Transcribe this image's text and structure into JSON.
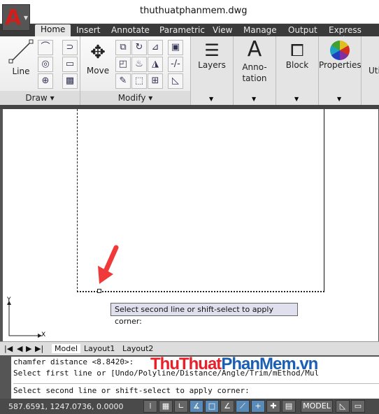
{
  "window": {
    "title": "thuthuatphanmem.dwg",
    "app_icon": "autocad-logo-icon"
  },
  "tabs": [
    "Home",
    "Insert",
    "Annotate",
    "Parametric",
    "View",
    "Manage",
    "Output",
    "Express Tools"
  ],
  "ribbon": {
    "draw": {
      "label": "Draw",
      "line": "Line"
    },
    "modify": {
      "label": "Modify",
      "move": "Move"
    },
    "layers": "Layers",
    "annotation": "Anno-\ntation",
    "block": "Block",
    "properties": "Properties",
    "utilities": "Uti"
  },
  "canvas": {
    "tooltip": "Select second line or shift-select to apply corner:",
    "ucs_x": "X",
    "ucs_y": "Y"
  },
  "layout_tabs": [
    "Model",
    "Layout1",
    "Layout2"
  ],
  "command": {
    "lines": [
      "chamfer distance <8.8420>: ",
      "Select first line or [Undo/Polyline/Distance/Angle/Trim/mEthod/Mul"
    ],
    "prompt": "Select second line or shift-select to apply corner:"
  },
  "status": {
    "coords": "587.6591, 1247.0736, 0.0000",
    "model": "MODEL"
  },
  "watermark": {
    "part1": "ThuThuat",
    "part2": "PhanMem.vn",
    "color1": "#e8202a",
    "color2": "#1a5fb4"
  }
}
